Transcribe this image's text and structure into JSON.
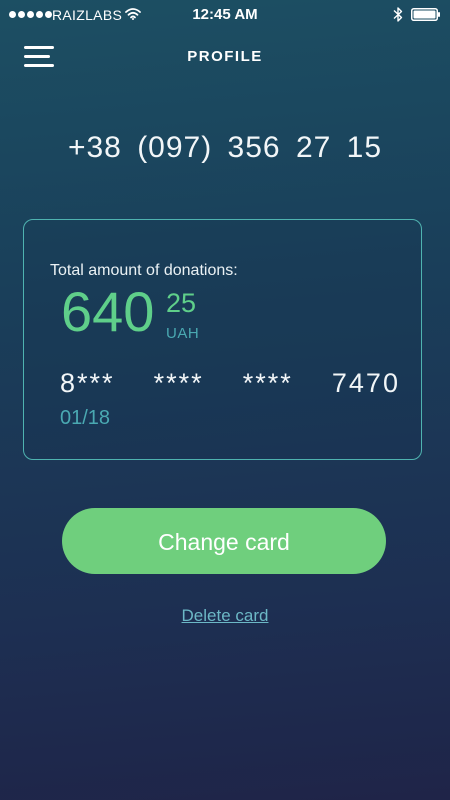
{
  "status_bar": {
    "carrier": "RAIZLABS",
    "time": "12:45 AM",
    "signal_icon": "signal-dots-icon",
    "wifi_icon": "wifi-icon",
    "bluetooth_icon": "bluetooth-icon",
    "battery_icon": "battery-icon",
    "battery_level": 1.0
  },
  "header": {
    "menu_icon": "hamburger-menu-icon",
    "title": "PROFILE"
  },
  "profile": {
    "phone_number": "+38 (097)  356  27  15"
  },
  "card": {
    "donations_label": "Total amount of donations:",
    "amount_main": "640",
    "amount_cents": "25",
    "currency": "UAH",
    "number_groups": [
      "8***",
      "****",
      "****",
      "7470"
    ],
    "expiry": "01/18"
  },
  "actions": {
    "change_card_label": "Change card",
    "delete_card_label": "Delete card"
  },
  "colors": {
    "accent_green": "#6fcf7d",
    "amount_green": "#5fcf8a",
    "teal": "#4aa9b2",
    "card_border": "#4fb3b0",
    "link": "#6cb8c6"
  }
}
